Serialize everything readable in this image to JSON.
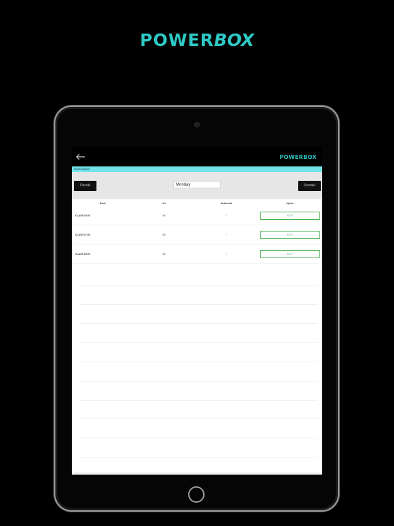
{
  "brand": {
    "power": "POWER",
    "box": "BOX"
  },
  "app": {
    "logo_power": "POWER",
    "logo_box": "BOX",
    "section_label": "Rezervasyon",
    "prev_label": "Önceki",
    "next_label": "Sonraki",
    "day_value": "Monday",
    "columns": [
      "Sınıf",
      "Kv",
      "Antrenör",
      "İşlem"
    ],
    "rows": [
      {
        "class": "CLASS 16:00",
        "kv": "0/0",
        "trainer": "/",
        "action": "KOY"
      },
      {
        "class": "CLASS 17:00",
        "kv": "0/0",
        "trainer": "/",
        "action": "KOY"
      },
      {
        "class": "CLASS 18:00",
        "kv": "0/0",
        "trainer": "/",
        "action": "KOY"
      }
    ]
  },
  "colors": {
    "accent": "#2ec9c5",
    "bar": "#6fe3e6",
    "action": "#4ab050"
  }
}
